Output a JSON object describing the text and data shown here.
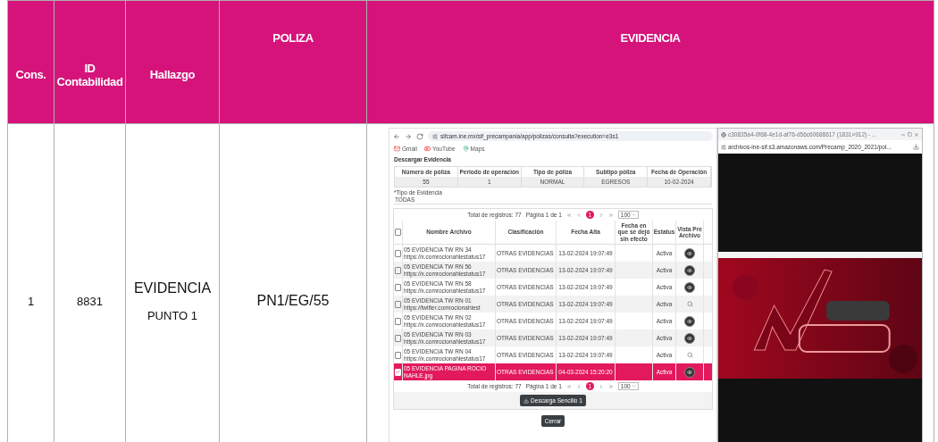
{
  "table": {
    "columns": [
      "Cons.",
      "ID Contabilidad",
      "Hallazgo",
      "POLIZA",
      "EVIDENCIA"
    ],
    "rows": [
      {
        "cons": "1",
        "id": "8831",
        "hallazgo": "EVIDENCIA",
        "hallazgo_detail": "PUNTO 1",
        "poliza": "PN1/EG/55"
      }
    ]
  },
  "evidence_screenshot": {
    "browser": {
      "url": "sifcam.ine.mx/sif_precampania/app/polizas/consulta?execution=e3s1",
      "bookmarks": [
        "Gmail",
        "YouTube",
        "Maps"
      ]
    },
    "page": {
      "title": "Descargar Evidencia",
      "summary": {
        "columns": [
          "Número de póliza",
          "Periodo de operación",
          "Tipo de póliza",
          "Subtipo póliza",
          "Fecha de Operación"
        ],
        "values": [
          "55",
          "1",
          "NORMAL",
          "EGRESOS",
          "10-02-2024"
        ]
      },
      "filter": {
        "label": "*Tipo de Evidencia",
        "value": "TODAS"
      },
      "pager_top": {
        "total": "Total de registros: 77",
        "page": "Página 1 de 1",
        "current": "1",
        "per_page": "100"
      },
      "files": {
        "select_all": {
          "checked": false
        },
        "columns": [
          "Nombre Archivo",
          "Clasificación",
          "Fecha Alta",
          "Fecha en que se dejó sin efecto",
          "Estatus",
          "Vista Pre Archivo"
        ],
        "rows": [
          {
            "name": "05 EVIDENCIA TW RN 34",
            "link": "https://x.comrocionahlestatus17",
            "classification": "OTRAS EVIDENCIAS",
            "date": "13-02-2024 19:07:49",
            "status": "Activa",
            "preview": {
              "kind": "view"
            },
            "checked": false,
            "selected": false
          },
          {
            "name": "05 EVIDENCIA TW RN 56",
            "link": "https://x.comrocionahlestatus17",
            "classification": "OTRAS EVIDENCIAS",
            "date": "13-02-2024 19:07:49",
            "status": "Activa",
            "preview": {
              "kind": "view"
            },
            "checked": false,
            "selected": false
          },
          {
            "name": "05 EVIDENCIA TW RN 58",
            "link": "https://x.comrocionahlestatus17",
            "classification": "OTRAS EVIDENCIAS",
            "date": "13-02-2024 19:07:49",
            "status": "Activa",
            "preview": {
              "kind": "view"
            },
            "checked": false,
            "selected": false
          },
          {
            "name": "05 EVIDENCIA TW RN 01",
            "link": "https://twitter.comrocionahlest",
            "classification": "OTRAS EVIDENCIAS",
            "date": "13-02-2024 19:07:49",
            "status": "Activa",
            "preview": {
              "kind": "search"
            },
            "checked": false,
            "selected": false
          },
          {
            "name": "05 EVIDENCIA TW RN 02",
            "link": "https://x.comrocionahlestatus17",
            "classification": "OTRAS EVIDENCIAS",
            "date": "13-02-2024 19:07:49",
            "status": "Activa",
            "preview": {
              "kind": "view"
            },
            "checked": false,
            "selected": false
          },
          {
            "name": "05 EVIDENCIA TW RN 03",
            "link": "https://x.comrocionahlestatus17",
            "classification": "OTRAS EVIDENCIAS",
            "date": "13-02-2024 19:07:49",
            "status": "Activa",
            "preview": {
              "kind": "view"
            },
            "checked": false,
            "selected": false
          },
          {
            "name": "05 EVIDENCIA TW RN 04",
            "link": "https://x.comrocionahlestatus17",
            "classification": "OTRAS EVIDENCIAS",
            "date": "13-02-2024 19:07:49",
            "status": "Activa",
            "preview": {
              "kind": "search"
            },
            "checked": false,
            "selected": false
          },
          {
            "name": "05 EVIDENCIA PAGINA ROCIO NAHLE.jpg",
            "classification": "OTRAS EVIDENCIAS",
            "date": "04-03-2024 15:20:20",
            "status": "Activa",
            "preview": {
              "kind": "view"
            },
            "checked": true,
            "selected": true
          }
        ]
      },
      "pager_bottom": {
        "total": "Total de registros: 77",
        "page": "Página 1 de 1",
        "current": "1",
        "per_page": "100"
      },
      "download_button": "Descarga Sencillo 1",
      "close_button": "Cerrar"
    },
    "popup": {
      "title": "c30835a4-0f68-4e1d-af76-d56c60688617 (1831×912) - ...",
      "url": "archivos-ine-sif.s3.amazonaws.com/Precamp_2020_2021/pol..."
    }
  }
}
